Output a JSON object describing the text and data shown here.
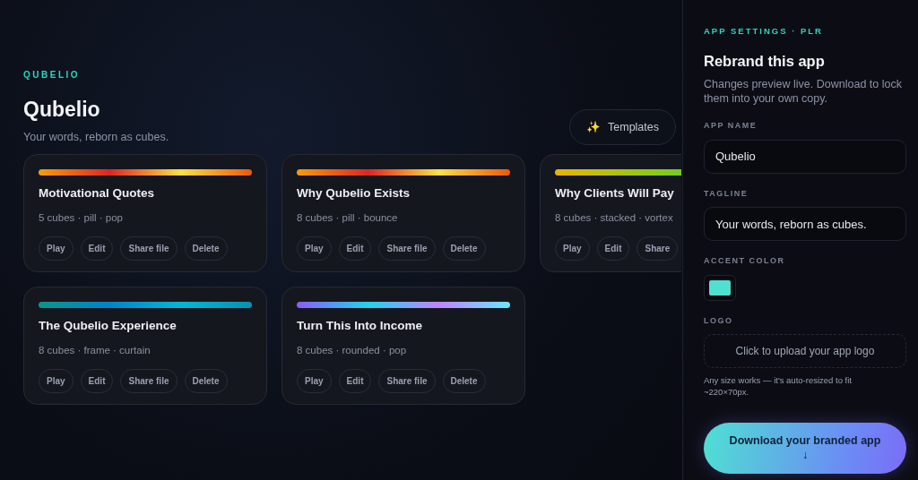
{
  "header": {
    "eyebrow": "QUBELIO",
    "title": "Qubelio",
    "tagline": "Your words, reborn as cubes.",
    "templates_button": {
      "icon": "✨",
      "label": "Templates"
    }
  },
  "cards": [
    {
      "title": "Motivational Quotes",
      "meta": "5 cubes · pill · pop",
      "kind": "sunset",
      "actions": [
        "Play",
        "Edit",
        "Share file",
        "Delete"
      ]
    },
    {
      "title": "Why Qubelio Exists",
      "meta": "8 cubes · pill · bounce",
      "kind": "sunset",
      "actions": [
        "Play",
        "Edit",
        "Share file",
        "Delete"
      ]
    },
    {
      "title": "Why Clients Will Pay",
      "meta": "8 cubes · stacked · vortex",
      "kind": "lime",
      "actions": [
        "Play",
        "Edit",
        "Share"
      ]
    },
    {
      "title": "The Qubelio Experience",
      "meta": "8 cubes · frame · curtain",
      "kind": "ocean",
      "actions": [
        "Play",
        "Edit",
        "Share file",
        "Delete"
      ]
    },
    {
      "title": "Turn This Into Income",
      "meta": "8 cubes · rounded · pop",
      "kind": "aurora",
      "actions": [
        "Play",
        "Edit",
        "Share file",
        "Delete"
      ]
    }
  ],
  "panel": {
    "eyebrow": "APP SETTINGS · PLR",
    "title": "Rebrand this app",
    "description": "Changes preview live. Download to lock them into your own copy.",
    "fields": [
      {
        "kind": "text",
        "label": "APP NAME",
        "value": "Qubelio"
      },
      {
        "kind": "text",
        "label": "TAGLINE",
        "value": "Your words, reborn as cubes."
      },
      {
        "kind": "color",
        "label": "ACCENT COLOR",
        "color": "#4fe0d2"
      },
      {
        "kind": "upload",
        "label": "LOGO",
        "prompt": "Click to upload your app logo",
        "hint": "Any size works — it's auto-resized to fit ~220×70px."
      }
    ],
    "download_button": {
      "label": "Download your branded app",
      "arrow": "↓"
    }
  }
}
